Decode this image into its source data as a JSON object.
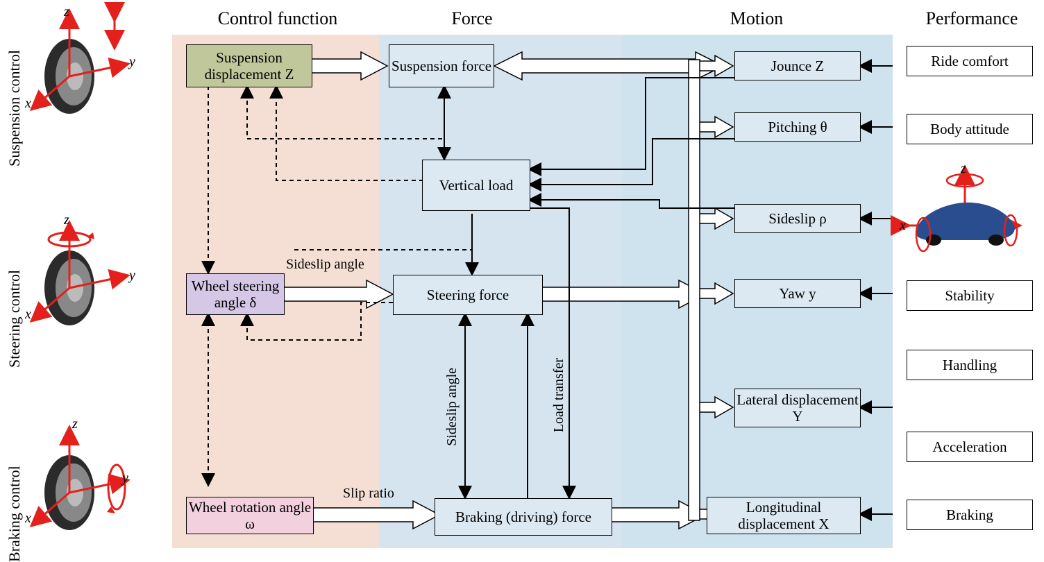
{
  "headers": {
    "control_function": "Control function",
    "force": "Force",
    "motion": "Motion",
    "performance": "Performance"
  },
  "rows": {
    "suspension": "Suspension control",
    "steering": "Steering control",
    "braking": "Braking control"
  },
  "axes": {
    "x": "x",
    "y": "y",
    "z": "z"
  },
  "control": {
    "suspension_disp": "Suspension displacement Z",
    "wheel_steer": "Wheel steering angle δ",
    "wheel_rot": "Wheel rotation angle ω"
  },
  "force": {
    "suspension": "Suspension force",
    "vertical": "Vertical load",
    "steering": "Steering force",
    "braking": "Braking (driving) force"
  },
  "motion": {
    "jounce": "Jounce Z",
    "pitching": "Pitching θ",
    "sideslip": "Sideslip ρ",
    "yaw": "Yaw y",
    "lateral": "Lateral displacement Y",
    "longitudinal": "Longitudinal displacement X"
  },
  "performance": {
    "ride": "Ride comfort",
    "body": "Body attitude",
    "stability": "Stability",
    "handling": "Handling",
    "accel": "Acceleration",
    "braking": "Braking"
  },
  "labels": {
    "sideslip_angle_top": "Sideslip angle",
    "slip_ratio": "Slip ratio",
    "sideslip_angle_v": "Sideslip angle",
    "load_transfer": "Load transfer"
  },
  "colors": {
    "zone_control": "#f5dfd4",
    "zone_force": "#d6e4ef",
    "zone_motion": "#cfe3ee",
    "box_susp_ctrl": "#c0c79a",
    "box_steer_ctrl": "#d6c7e6",
    "box_brake_ctrl": "#f3d0de",
    "box_blue": "#dce9f2",
    "arrow_red": "#e3201b"
  }
}
